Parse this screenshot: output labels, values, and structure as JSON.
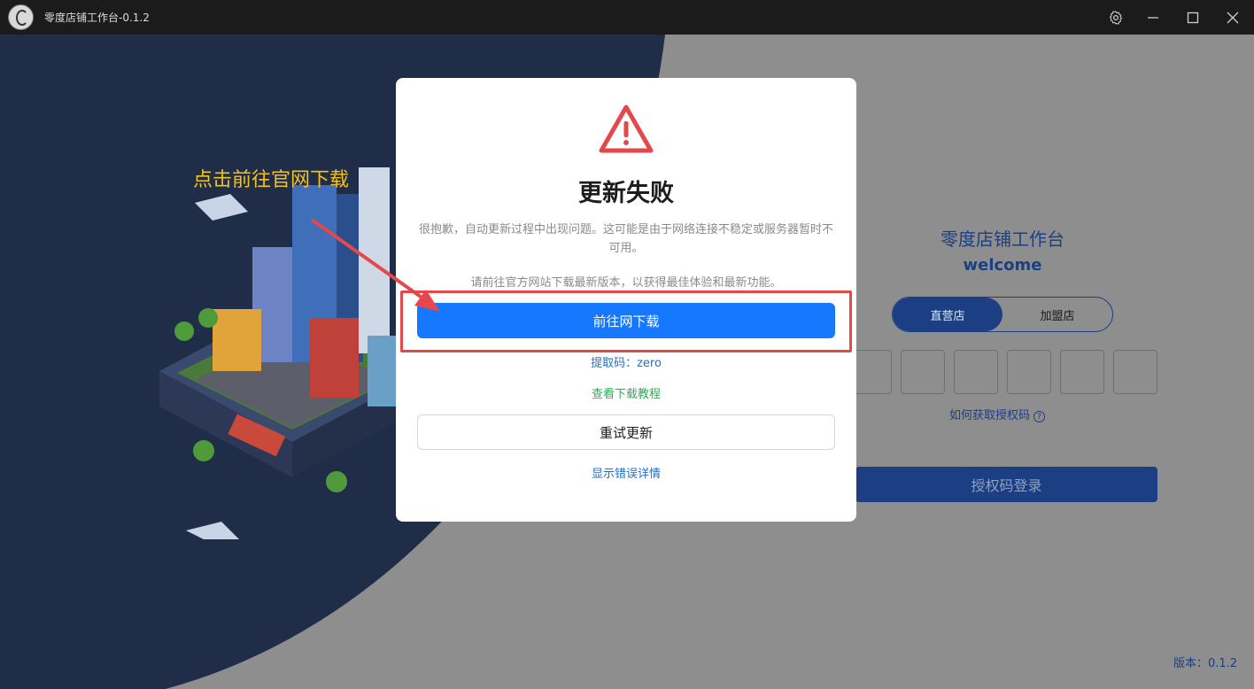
{
  "window": {
    "title": "零度店铺工作台-0.1.2",
    "icons": [
      "logo-icon",
      "gear-icon",
      "minimize-icon",
      "maximize-icon",
      "close-icon"
    ]
  },
  "annotation": {
    "text": "点击前往官网下载",
    "color": "#f4c21a"
  },
  "login": {
    "title": "零度店铺工作台",
    "welcome": "welcome",
    "tabs": [
      {
        "label": "直营店",
        "active": true
      },
      {
        "label": "加盟店",
        "active": false
      }
    ],
    "auth_help": "如何获取授权码",
    "auth_help_icon": "question-circle-icon",
    "login_button": "授权码登录",
    "version": "版本：0.1.2"
  },
  "dialog": {
    "icon": "warning-triangle-icon",
    "title": "更新失败",
    "message": "很抱歉，自动更新过程中出现问题。这可能是由于网络连接不稳定或服务器暂时不可用。",
    "hint": "请前往官方网站下载最新版本，以获得最佳体验和最新功能。",
    "primary_button": "前往网下载",
    "extract_code": "提取码：zero",
    "tutorial_link": "查看下载教程",
    "retry_button": "重试更新",
    "details_link": "显示错误详情"
  },
  "colors": {
    "primary": "#1677ff",
    "warning": "#e5484b",
    "link": "#1c6fd1",
    "success_link": "#2eaa55",
    "brand_dark": "#1b3f82"
  }
}
